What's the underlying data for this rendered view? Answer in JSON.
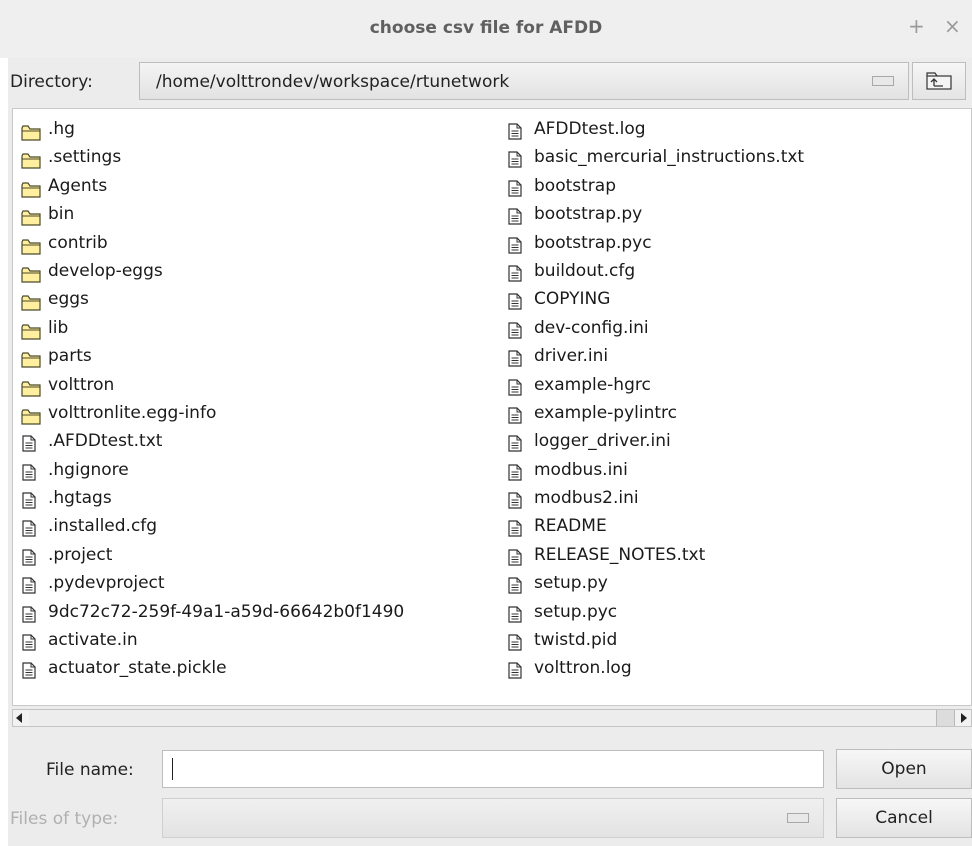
{
  "window": {
    "title": "choose csv file for AFDD",
    "plus_glyph": "+",
    "close_glyph": "×"
  },
  "directory": {
    "label": "Directory:",
    "value": "/home/volttrondev/workspace/rtunetwork"
  },
  "listing": {
    "column1": [
      {
        "name": ".hg",
        "type": "folder"
      },
      {
        "name": ".settings",
        "type": "folder"
      },
      {
        "name": "Agents",
        "type": "folder"
      },
      {
        "name": "bin",
        "type": "folder"
      },
      {
        "name": "contrib",
        "type": "folder"
      },
      {
        "name": "develop-eggs",
        "type": "folder"
      },
      {
        "name": "eggs",
        "type": "folder"
      },
      {
        "name": "lib",
        "type": "folder"
      },
      {
        "name": "parts",
        "type": "folder"
      },
      {
        "name": "volttron",
        "type": "folder"
      },
      {
        "name": "volttronlite.egg-info",
        "type": "folder"
      },
      {
        "name": ".AFDDtest.txt",
        "type": "file"
      },
      {
        "name": ".hgignore",
        "type": "file"
      },
      {
        "name": ".hgtags",
        "type": "file"
      },
      {
        "name": ".installed.cfg",
        "type": "file"
      },
      {
        "name": ".project",
        "type": "file"
      },
      {
        "name": ".pydevproject",
        "type": "file"
      },
      {
        "name": "9dc72c72-259f-49a1-a59d-66642b0f1490",
        "type": "file"
      },
      {
        "name": "activate.in",
        "type": "file"
      },
      {
        "name": "actuator_state.pickle",
        "type": "file"
      }
    ],
    "column2": [
      {
        "name": "AFDDtest.log",
        "type": "file"
      },
      {
        "name": "basic_mercurial_instructions.txt",
        "type": "file"
      },
      {
        "name": "bootstrap",
        "type": "file"
      },
      {
        "name": "bootstrap.py",
        "type": "file"
      },
      {
        "name": "bootstrap.pyc",
        "type": "file"
      },
      {
        "name": "buildout.cfg",
        "type": "file"
      },
      {
        "name": "COPYING",
        "type": "file"
      },
      {
        "name": "dev-config.ini",
        "type": "file"
      },
      {
        "name": "driver.ini",
        "type": "file"
      },
      {
        "name": "example-hgrc",
        "type": "file"
      },
      {
        "name": "example-pylintrc",
        "type": "file"
      },
      {
        "name": "logger_driver.ini",
        "type": "file"
      },
      {
        "name": "modbus.ini",
        "type": "file"
      },
      {
        "name": "modbus2.ini",
        "type": "file"
      },
      {
        "name": "README",
        "type": "file"
      },
      {
        "name": "RELEASE_NOTES.txt",
        "type": "file"
      },
      {
        "name": "setup.py",
        "type": "file"
      },
      {
        "name": "setup.pyc",
        "type": "file"
      },
      {
        "name": "twistd.pid",
        "type": "file"
      },
      {
        "name": "volttron.log",
        "type": "file"
      }
    ]
  },
  "file_name": {
    "label": "File name:",
    "value": ""
  },
  "files_of_type": {
    "label": "Files of type:",
    "value": ""
  },
  "buttons": {
    "open": "Open",
    "cancel": "Cancel"
  },
  "colors": {
    "folder_fill": "#ffef9e",
    "folder_stroke": "#4a4a2a",
    "titlebar": "#efefef",
    "dialog_bg": "#ececec"
  },
  "icons": {
    "folder": "folder-icon",
    "file": "file-icon",
    "parent_directory": "parent-directory-icon"
  }
}
